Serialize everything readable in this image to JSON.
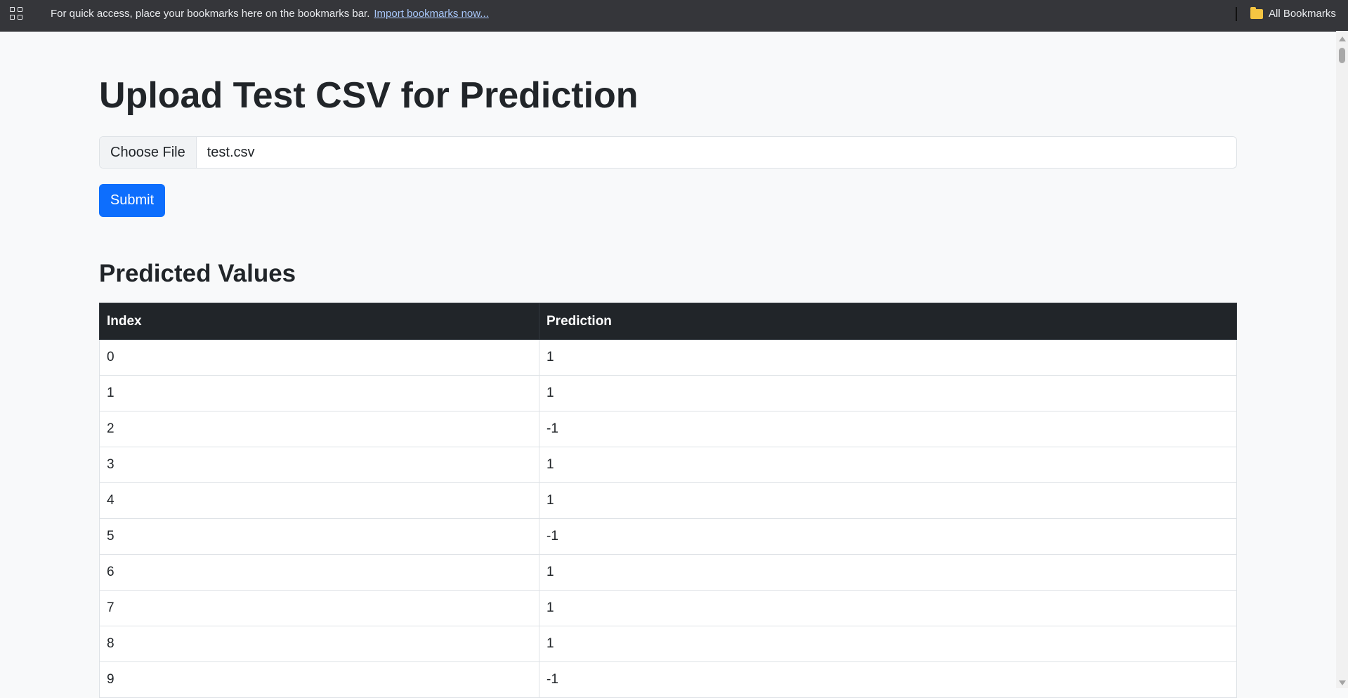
{
  "bookmarks_bar": {
    "message": "For quick access, place your bookmarks here on the bookmarks bar.",
    "import_link": "Import bookmarks now...",
    "all_bookmarks": "All Bookmarks"
  },
  "page": {
    "title": "Upload Test CSV for Prediction",
    "file_input": {
      "button_label": "Choose File",
      "file_name": "test.csv"
    },
    "submit_label": "Submit",
    "results_title": "Predicted Values",
    "table": {
      "headers": [
        "Index",
        "Prediction"
      ],
      "rows": [
        [
          "0",
          "1"
        ],
        [
          "1",
          "1"
        ],
        [
          "2",
          "-1"
        ],
        [
          "3",
          "1"
        ],
        [
          "4",
          "1"
        ],
        [
          "5",
          "-1"
        ],
        [
          "6",
          "1"
        ],
        [
          "7",
          "1"
        ],
        [
          "8",
          "1"
        ],
        [
          "9",
          "-1"
        ]
      ]
    }
  },
  "colors": {
    "primary": "#0d6efd",
    "table_header_bg": "#212529",
    "page_bg": "#f8f9fa",
    "bookmarks_bar_bg": "#35363a"
  }
}
